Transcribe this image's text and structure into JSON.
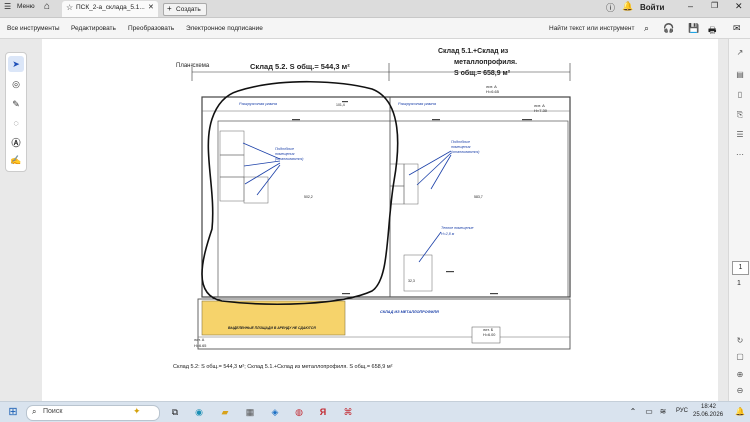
{
  "titlebar": {
    "menu_label": "Меню",
    "tab_label": "ПСК_2-а_склада_5.1...",
    "new_tab_label": "Создать",
    "login_label": "Войти"
  },
  "toolbar": {
    "items": [
      "Все инструменты",
      "Редактировать",
      "Преобразовать",
      "Электронное подписание"
    ],
    "find_label": "Найти текст или инструмент"
  },
  "page_nav": {
    "current_page": "1",
    "total_pages": "1"
  },
  "plan": {
    "caption_label": "План-схема",
    "header_left": "Склад 5.2.  S общ.= 544,3 м²",
    "header_right_line1": "Склад 5.1.+Склад из",
    "header_right_line2": "металлопрофиля.",
    "header_right_line3": "S общ.= 658,9 м²",
    "ramp_left": "Разгрузочная рампа",
    "ramp_right": "Разгрузочная рампа",
    "aux_left_line1": "Подсобные",
    "aux_left_line2": "помещения",
    "aux_left_line3": "(отапливаются)",
    "aux_right_line1": "Подсобные",
    "aux_right_line2": "помещения",
    "aux_right_line3": "(отапливаются)",
    "warm_room_line1": "Теплое помещение",
    "warm_room_line2": "Н=2,8 м",
    "highlight_label": "ВЫДЕЛЕННЫЕ ПЛОЩАДИ В АРЕНДУ НЕ СДАЮТСЯ",
    "metal_warehouse_label": "СКЛАД ИЗ МЕТАЛЛОПРОФИЛЯ",
    "bottom_caption": "Склад 5.2: S общ.= 544,3 м²; Склад 5.1.+Склад из металлопрофиля. S общ.= 658,9 м²",
    "lit_a_top": "лит. А",
    "lit_a_top_h": "Н=6.65",
    "lit_a_right": "лит. А",
    "lit_a_right_h": "Н=7.30",
    "lit_b": "лит. Б",
    "lit_b_h": "Н=6.00",
    "lit_a_bottom": "лит. А",
    "lit_a_bottom_h": "Н=6.65",
    "room_left_main": "502,2",
    "room_right_main": "583,7",
    "room_top_left": "101,4",
    "room_right_small": "32,3"
  },
  "taskbar": {
    "search_placeholder": "Поиск",
    "language": "РУС",
    "time": "18:42",
    "date": "25.06.2026"
  },
  "colors": {
    "highlight": "#f6d36b",
    "link_blue": "#1a3fa8",
    "accent_red": "#c2262e"
  }
}
